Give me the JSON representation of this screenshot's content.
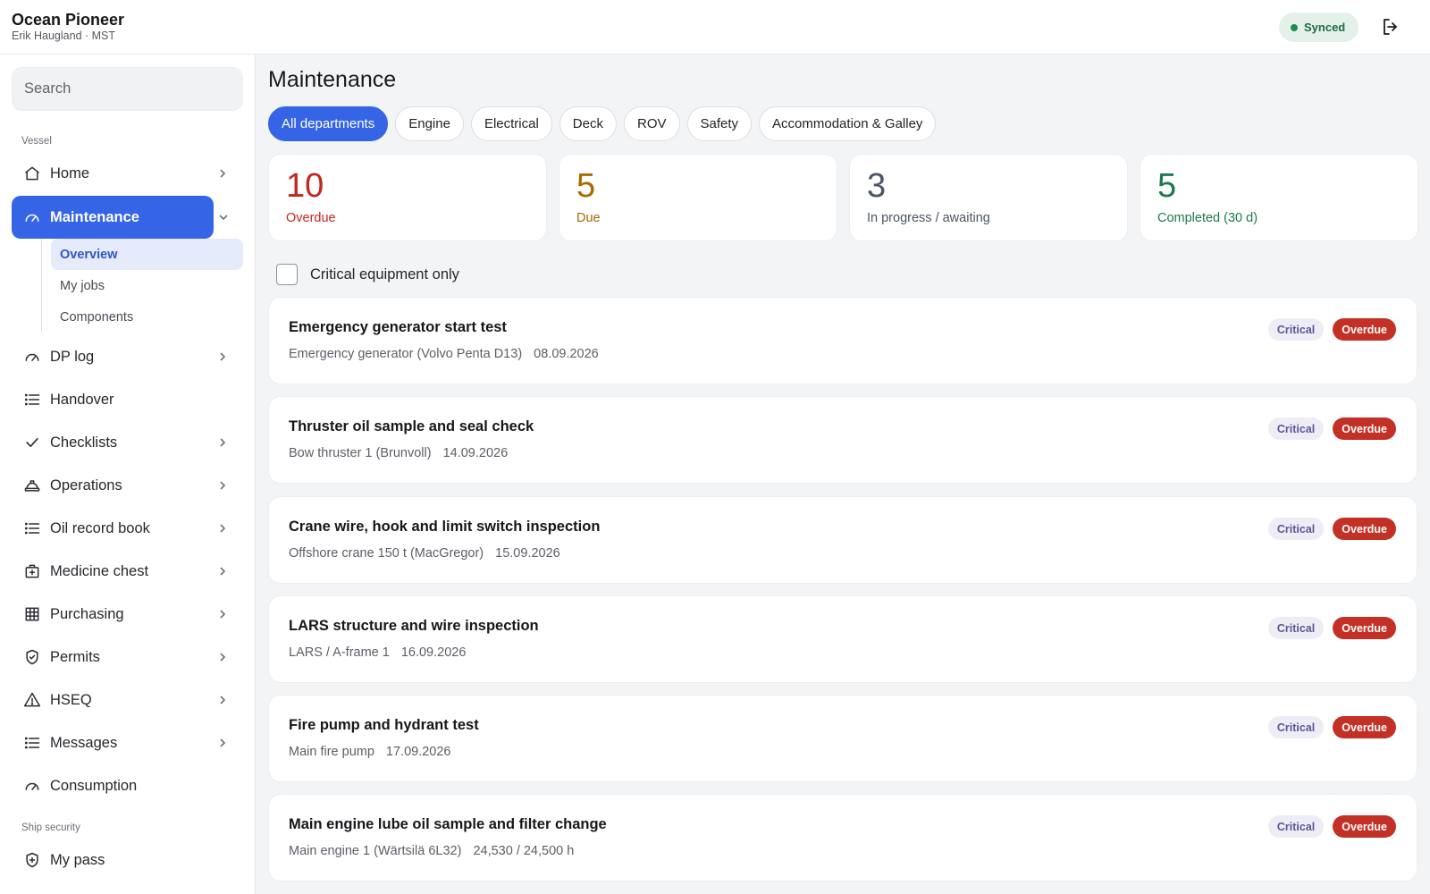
{
  "header": {
    "vessel_name": "Ocean Pioneer",
    "user_line": "Erik Haugland · MST",
    "sync_status": "Synced",
    "logout_icon": "logout-icon"
  },
  "sidebar": {
    "search_placeholder": "Search",
    "section_vessel": "Vessel",
    "section_security": "Ship security",
    "items": [
      {
        "label": "Home",
        "icon": "home-icon"
      },
      {
        "label": "Maintenance",
        "icon": "gauge-icon"
      },
      {
        "label": "DP log",
        "icon": "gauge-icon"
      },
      {
        "label": "Handover",
        "icon": "list-icon"
      },
      {
        "label": "Checklists",
        "icon": "check-icon"
      },
      {
        "label": "Operations",
        "icon": "hardhat-icon"
      },
      {
        "label": "Oil record book",
        "icon": "list-icon"
      },
      {
        "label": "Medicine chest",
        "icon": "medkit-icon"
      },
      {
        "label": "Purchasing",
        "icon": "grid-icon"
      },
      {
        "label": "Permits",
        "icon": "shield-doc-icon"
      },
      {
        "label": "HSEQ",
        "icon": "warning-icon"
      },
      {
        "label": "Messages",
        "icon": "list-icon"
      },
      {
        "label": "Consumption",
        "icon": "gauge-icon"
      },
      {
        "label": "My pass",
        "icon": "shield-plus-icon"
      }
    ],
    "maintenance_sub": [
      "Overview",
      "My jobs",
      "Components"
    ]
  },
  "main": {
    "title": "Maintenance",
    "departments": [
      "All departments",
      "Engine",
      "Electrical",
      "Deck",
      "ROV",
      "Safety",
      "Accommodation & Galley"
    ],
    "active_department": "All departments",
    "stats": [
      {
        "value": "10",
        "label": "Overdue",
        "color": "#c0281f"
      },
      {
        "value": "5",
        "label": "Due",
        "color": "#a86a00"
      },
      {
        "value": "3",
        "label": "In progress / awaiting",
        "color": "#4a5563"
      },
      {
        "value": "5",
        "label": "Completed (30 d)",
        "color": "#1a7a4c"
      }
    ],
    "filter_label": "Critical equipment only",
    "jobs": [
      {
        "title": "Emergency generator start test",
        "component": "Emergency generator (Volvo Penta D13)",
        "due": "08.09.2026",
        "tag1": "Critical",
        "tag2": "Overdue"
      },
      {
        "title": "Thruster oil sample and seal check",
        "component": "Bow thruster 1 (Brunvoll)",
        "due": "14.09.2026",
        "tag1": "Critical",
        "tag2": "Overdue"
      },
      {
        "title": "Crane wire, hook and limit switch inspection",
        "component": "Offshore crane 150 t (MacGregor)",
        "due": "15.09.2026",
        "tag1": "Critical",
        "tag2": "Overdue"
      },
      {
        "title": "LARS structure and wire inspection",
        "component": "LARS / A-frame 1",
        "due": "16.09.2026",
        "tag1": "Critical",
        "tag2": "Overdue"
      },
      {
        "title": "Fire pump and hydrant test",
        "component": "Main fire pump",
        "due": "17.09.2026",
        "tag1": "Critical",
        "tag2": "Overdue"
      },
      {
        "title": "Main engine lube oil sample and filter change",
        "component": "Main engine 1 (Wärtsilä 6L32)",
        "due": "24,530 / 24,500 h",
        "tag1": "Critical",
        "tag2": "Overdue"
      }
    ]
  }
}
